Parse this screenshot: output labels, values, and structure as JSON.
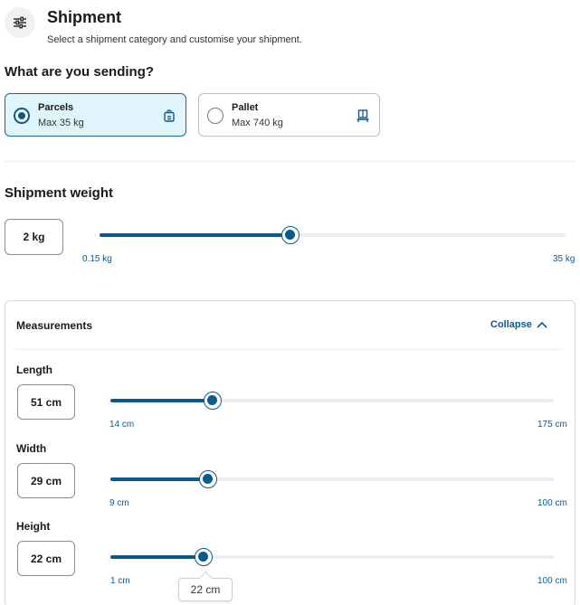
{
  "header": {
    "title": "Shipment",
    "subtitle": "Select a shipment category and customise your shipment.",
    "icon": "sliders-icon"
  },
  "category": {
    "heading": "What are you sending?",
    "options": [
      {
        "name": "Parcels",
        "sub": "Max 35 kg",
        "selected": true,
        "icon": "parcel-bag-icon"
      },
      {
        "name": "Pallet",
        "sub": "Max 740 kg",
        "selected": false,
        "icon": "pallet-icon"
      }
    ]
  },
  "weight": {
    "heading": "Shipment weight",
    "value_label": "2 kg",
    "min_label": "0.15 kg",
    "max_label": "35 kg",
    "fraction": 0.41
  },
  "measurements": {
    "title": "Measurements",
    "collapse_label": "Collapse",
    "items": [
      {
        "label": "Length",
        "value_label": "51 cm",
        "min_label": "14 cm",
        "max_label": "175 cm",
        "fraction": 0.23
      },
      {
        "label": "Width",
        "value_label": "29 cm",
        "min_label": "9 cm",
        "max_label": "100 cm",
        "fraction": 0.22
      },
      {
        "label": "Height",
        "value_label": "22 cm",
        "min_label": "1 cm",
        "max_label": "100 cm",
        "fraction": 0.21
      }
    ],
    "tooltip": "22 cm"
  },
  "colors": {
    "accent": "#0b5a8c",
    "selected_bg": "#dff4fb",
    "track": "#ececec"
  }
}
